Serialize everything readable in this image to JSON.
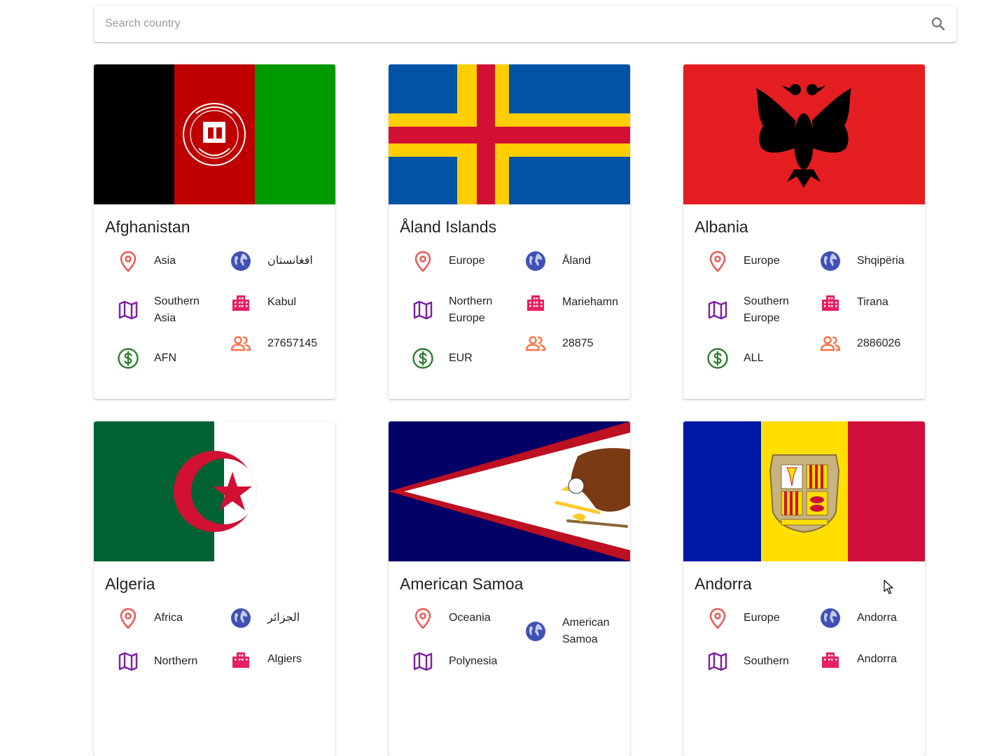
{
  "search": {
    "placeholder": "Search country",
    "icon": "search-icon"
  },
  "icons": {
    "region": "map-pin-icon",
    "native_name": "globe-icon",
    "subregion": "map-icon",
    "capital": "city-icon",
    "currency": "dollar-icon",
    "population": "people-icon"
  },
  "colors": {
    "pin": "#ef5350",
    "globe": "#3f51b5",
    "map": "#7b1fa2",
    "city": "#e91e63",
    "dollar": "#2e7d32",
    "people": "#ff7043"
  },
  "countries": [
    {
      "name": "Afghanistan",
      "region": "Asia",
      "native_name": "افغانستان",
      "subregion": "Southern Asia",
      "capital": "Kabul",
      "currency": "AFN",
      "population": "27657145",
      "flag_colors": [
        "#000000",
        "#be0000",
        "#009900"
      ]
    },
    {
      "name": "Åland Islands",
      "region": "Europe",
      "native_name": "Åland",
      "subregion": "Northern Europe",
      "capital": "Mariehamn",
      "currency": "EUR",
      "population": "28875",
      "flag_colors": [
        "#0053a5",
        "#ffce00",
        "#d21034"
      ]
    },
    {
      "name": "Albania",
      "region": "Europe",
      "native_name": "Shqipëria",
      "subregion": "Southern Europe",
      "capital": "Tirana",
      "currency": "ALL",
      "population": "2886026",
      "flag_colors": [
        "#e41e20",
        "#000000"
      ]
    },
    {
      "name": "Algeria",
      "region": "Africa",
      "native_name": "الجزائر",
      "subregion": "Northern",
      "capital": "Algiers",
      "flag_colors": [
        "#006233",
        "#ffffff",
        "#d21034"
      ]
    },
    {
      "name": "American Samoa",
      "region": "Oceania",
      "native_name": "American Samoa",
      "subregion": "Polynesia",
      "flag_colors": [
        "#000066",
        "#bd1021",
        "#ffffff"
      ]
    },
    {
      "name": "Andorra",
      "region": "Europe",
      "native_name": "Andorra",
      "subregion": "Southern",
      "capital": "Andorra",
      "flag_colors": [
        "#0018a8",
        "#fedf00",
        "#d0103a"
      ]
    }
  ]
}
